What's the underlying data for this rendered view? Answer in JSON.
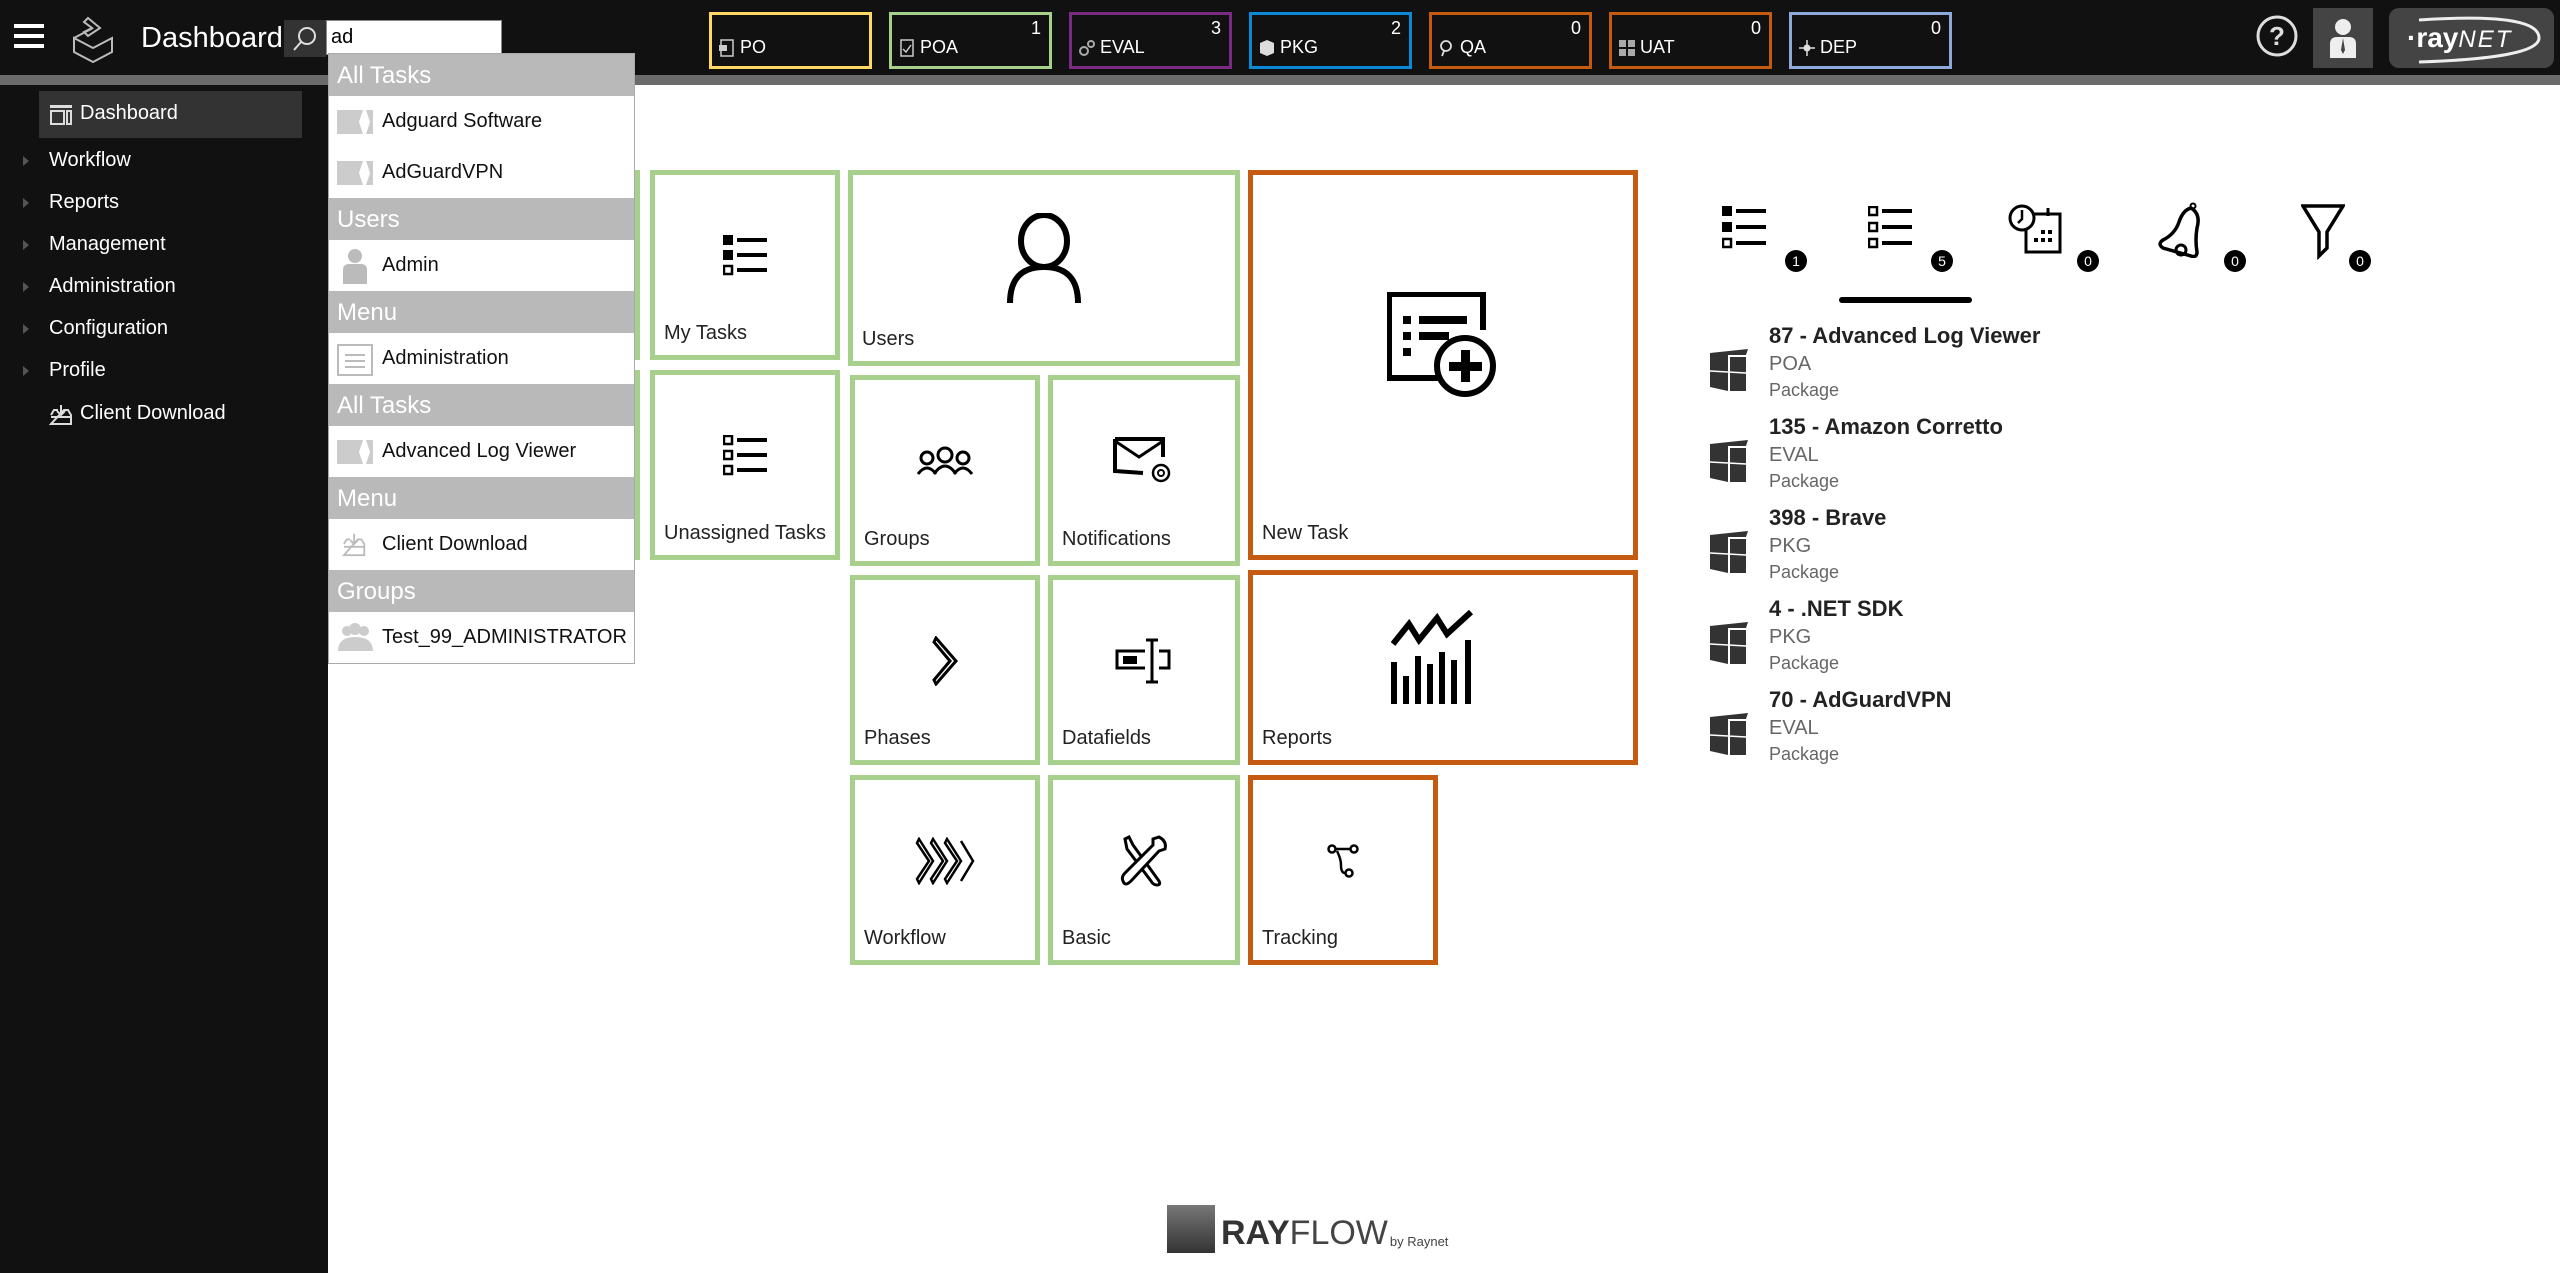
{
  "header": {
    "title": "Dashboard",
    "search_value": "ad",
    "search_placeholder": "",
    "phases": [
      {
        "label": "PO",
        "count": "",
        "color": "#ffd966",
        "icon": "po-icon"
      },
      {
        "label": "POA",
        "count": "1",
        "color": "#a8d08d",
        "icon": "poa-icon"
      },
      {
        "label": "EVAL",
        "count": "3",
        "color": "#7b2c82",
        "icon": "eval-gears-icon"
      },
      {
        "label": "PKG",
        "count": "2",
        "color": "#0b8ad8",
        "icon": "pkg-box-icon"
      },
      {
        "label": "QA",
        "count": "0",
        "color": "#c55a11",
        "icon": "qa-search-icon"
      },
      {
        "label": "UAT",
        "count": "0",
        "color": "#c55a11",
        "icon": "uat-checklist-icon"
      },
      {
        "label": "DEP",
        "count": "0",
        "color": "#8eaadb",
        "icon": "dep-deploy-icon"
      }
    ],
    "brand": {
      "dot_text": "·ray",
      "suffix": "NET"
    }
  },
  "sidebar": {
    "items": [
      {
        "label": "Dashboard",
        "active": true,
        "icon": "dashboard-icon"
      },
      {
        "label": "Workflow"
      },
      {
        "label": "Reports"
      },
      {
        "label": "Management"
      },
      {
        "label": "Administration"
      },
      {
        "label": "Configuration"
      },
      {
        "label": "Profile"
      },
      {
        "label": "Client Download",
        "icon": "download-icon"
      }
    ]
  },
  "search_results": [
    {
      "header": "All Tasks",
      "items": [
        {
          "label": "Adguard Software",
          "icon": "task-icon"
        },
        {
          "label": "AdGuardVPN",
          "icon": "task-icon"
        }
      ]
    },
    {
      "header": "Users",
      "items": [
        {
          "label": "Admin",
          "icon": "user-icon"
        }
      ]
    },
    {
      "header": "Menu",
      "items": [
        {
          "label": "Administration",
          "icon": "menu-icon"
        }
      ]
    },
    {
      "header": "All Tasks",
      "items": [
        {
          "label": "Advanced Log Viewer",
          "icon": "task-icon"
        }
      ]
    },
    {
      "header": "Menu",
      "items": [
        {
          "label": "Client Download",
          "icon": "download-icon"
        }
      ]
    },
    {
      "header": "Groups",
      "items": [
        {
          "label": "Test_99_ADMINISTRATOR",
          "icon": "group-icon"
        }
      ]
    }
  ],
  "tiles": {
    "my_tasks": "My Tasks",
    "unassigned_tasks": "Unassigned Tasks",
    "users": "Users",
    "groups": "Groups",
    "notifications": "Notifications",
    "new_task": "New Task",
    "phases": "Phases",
    "datafields": "Datafields",
    "reports": "Reports",
    "workflow": "Workflow",
    "basic": "Basic",
    "tracking": "Tracking"
  },
  "right_panel": {
    "tabs": [
      {
        "name": "my-tasks",
        "count": "1"
      },
      {
        "name": "unassigned-tasks",
        "count": "5",
        "active": true
      },
      {
        "name": "scheduled",
        "count": "0"
      },
      {
        "name": "alerts",
        "count": "0"
      },
      {
        "name": "filters",
        "count": "0"
      }
    ],
    "items": [
      {
        "title": "87 - Advanced Log Viewer",
        "phase": "POA",
        "type": "Package"
      },
      {
        "title": "135 - Amazon Corretto",
        "phase": "EVAL",
        "type": "Package"
      },
      {
        "title": "398 - Brave",
        "phase": "PKG",
        "type": "Package"
      },
      {
        "title": "4 - .NET SDK",
        "phase": "PKG",
        "type": "Package"
      },
      {
        "title": "70 - AdGuardVPN",
        "phase": "EVAL",
        "type": "Package"
      }
    ]
  },
  "footer": {
    "brand_bold": "RAY",
    "brand_light": "FLOW",
    "by": "by Raynet"
  }
}
